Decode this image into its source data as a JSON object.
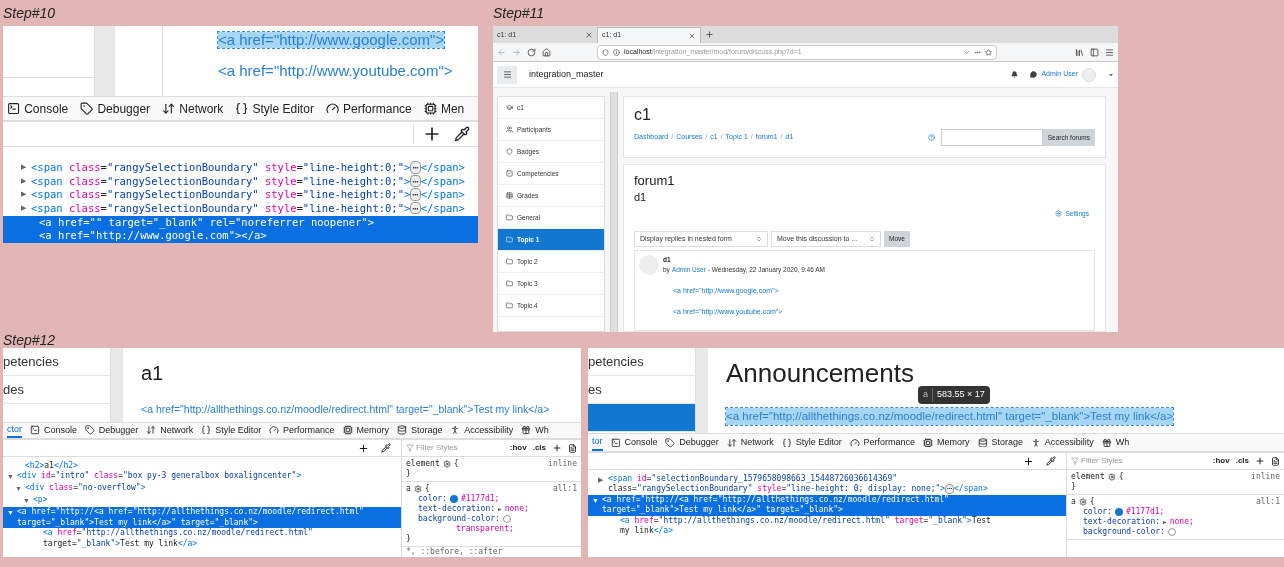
{
  "step10": {
    "label": "Step#10",
    "page_links": [
      {
        "text": "<a href=\"http://www.google.com\">",
        "selected": true
      },
      {
        "text": "<a href=\"http://www.youtube.com\">",
        "selected": false
      }
    ],
    "devtools_tabs": [
      {
        "label": "Console",
        "kind": "console",
        "selected": false
      },
      {
        "label": "Debugger",
        "kind": "debugger",
        "selected": false
      },
      {
        "label": "Network",
        "kind": "network",
        "selected": false
      },
      {
        "label": "Style Editor",
        "kind": "style",
        "selected": false
      },
      {
        "label": "Performance",
        "kind": "performance",
        "selected": false
      },
      {
        "label": "Men",
        "kind": "memory",
        "selected": false
      }
    ],
    "markup": [
      {
        "lines": [
          "<span class=\"rangySelectionBoundary\" style=\"line-height:0;\">⋯</span>"
        ],
        "arrow": "▶",
        "selected": false
      },
      {
        "lines": [
          "<span class=\"rangySelectionBoundary\" style=\"line-height:0;\">⋯</span>"
        ],
        "arrow": "▶",
        "selected": false
      },
      {
        "lines": [
          "<span class=\"rangySelectionBoundary\" style=\"line-height:0;\">⋯</span>"
        ],
        "arrow": "▶",
        "selected": false
      },
      {
        "lines": [
          "<span class=\"rangySelectionBoundary\" style=\"line-height:0;\">⋯</span>"
        ],
        "arrow": "▶",
        "selected": false
      },
      {
        "lines": [
          "<a href=\"\" target=\"_blank\" rel=\"noreferrer noopener\">",
          "<a href=\"http://www.google.com\"></a>"
        ],
        "selected": true
      }
    ]
  },
  "step11": {
    "label": "Step#11",
    "tabs": [
      {
        "label": "c1: d1",
        "selected": false
      },
      {
        "label": "c1: d1",
        "selected": true
      }
    ],
    "url_host": "localhost",
    "url_path": "/integration_master/mod/forum/discuss.php?d=1",
    "site_name": "integration_master",
    "user": "Admin User",
    "nav": [
      {
        "label": "c1",
        "kind": "course",
        "selected": false
      },
      {
        "label": "Participants",
        "kind": "participants",
        "selected": false
      },
      {
        "label": "Badges",
        "kind": "badges",
        "selected": false
      },
      {
        "label": "Competencies",
        "kind": "competencies",
        "selected": false
      },
      {
        "label": "Grades",
        "kind": "grades",
        "selected": false
      },
      {
        "label": "General",
        "kind": "section",
        "selected": false
      },
      {
        "label": "Topic 1",
        "kind": "section",
        "selected": true
      },
      {
        "label": "Topic 2",
        "kind": "section",
        "selected": false
      },
      {
        "label": "Topic 3",
        "kind": "section",
        "selected": false
      },
      {
        "label": "Topic 4",
        "kind": "section",
        "selected": false
      }
    ],
    "heading": "c1",
    "breadcrumb": [
      "Dashboard",
      "Courses",
      "c1",
      "Topic 1",
      "forum1",
      "d1"
    ],
    "breadcrumb_separator": "/",
    "search_button": "Search forums",
    "forum": "forum1",
    "discussion": "d1",
    "settings": "Settings",
    "display_select": "Display replies in nested form",
    "move_select": "Move this discussion to ...",
    "move_button": "Move",
    "post": {
      "title": "d1",
      "by": "by",
      "author": "Admin User",
      "date": "- Wednesday, 22 January 2020, 9:46 AM",
      "body": [
        "<a href=\"http://www.google.com\">",
        "<a href=\"http://www.youtube.com\">"
      ]
    }
  },
  "step12": {
    "label": "Step#12",
    "left": {
      "nav": [
        {
          "label": "petencies",
          "selected": false
        },
        {
          "label": "des",
          "selected": false
        }
      ],
      "heading": "a1",
      "link": "<a href=\"http://allthethings.co.nz/moodle/redirect.html\" target=\"_blank\">Test my link</a>",
      "link_selected": false,
      "devtools_tabs": [
        {
          "label": "ctor",
          "kind": "inspector",
          "selected": true
        },
        {
          "label": "Console",
          "kind": "console",
          "selected": false
        },
        {
          "label": "Debugger",
          "kind": "debugger",
          "selected": false
        },
        {
          "label": "Network",
          "kind": "network",
          "selected": false
        },
        {
          "label": "Style Editor",
          "kind": "style",
          "selected": false
        },
        {
          "label": "Performance",
          "kind": "performance",
          "selected": false
        },
        {
          "label": "Memory",
          "kind": "memory",
          "selected": false
        },
        {
          "label": "Storage",
          "kind": "storage",
          "selected": false
        },
        {
          "label": "Accessibility",
          "kind": "accessibility",
          "selected": false
        },
        {
          "label": "Wh",
          "kind": "whatsnew",
          "selected": false
        }
      ],
      "markup": [
        {
          "lines": [
            "<h2>a1</h2>"
          ],
          "selected": false
        },
        {
          "lines": [
            "<div id=\"intro\" class=\"box py-3 generalbox boxaligncenter\">"
          ],
          "arrow": "▼",
          "selected": false
        },
        {
          "lines": [
            "<div class=\"no-overflow\">"
          ],
          "arrow": "▼",
          "selected": false
        },
        {
          "lines": [
            "<p>"
          ],
          "arrow": "▼",
          "selected": false
        },
        {
          "lines": [
            "<a href=\"http://<a href=\"http://allthethings.co.nz/moodle/redirect.html\"",
            "target=\"_blank\">Test my link</a>\" target=\"_blank\">"
          ],
          "arrow": "▼",
          "selected": true
        },
        {
          "lines": [
            "<a href=\"http://allthethings.co.nz/moodle/redirect.html\"",
            "target=\"_blank\">Test my link</a>"
          ],
          "selected": false
        }
      ],
      "filter_placeholder": "Filter Styles",
      "hov": ":hov",
      "cls": ".cls",
      "rules": [
        {
          "selector": "element",
          "open": "{",
          "close": "}",
          "source": "inline"
        },
        {
          "selector": "a",
          "open": "{",
          "close": "}",
          "source": "all:1",
          "props": [
            {
              "name": "color:",
              "kind": "color",
              "value": "#1177d1;",
              "color": "#1177d1"
            },
            {
              "name": "text-decoration:",
              "kind": "plain",
              "arrow": "▶",
              "value": "none;"
            },
            {
              "name": "background-color:",
              "kind": "color",
              "value_below": "transparent;"
            }
          ]
        }
      ],
      "rules_more": "*, ::before, ::after"
    },
    "right": {
      "nav": [
        {
          "label": "petencies",
          "selected": false
        },
        {
          "label": "es",
          "selected": false
        },
        {
          "selected": true
        }
      ],
      "heading": "Announcements",
      "tooltip_tag": "a",
      "tooltip_size": "583.55 × 17",
      "link": "<a href=\"http://allthethings.co.nz/moodle/redirect.html\" target=\"_blank\">Test my link</a>",
      "link_selected": true,
      "devtools_tabs": [
        {
          "label": "tor",
          "kind": "inspector",
          "selected": true
        },
        {
          "label": "Console",
          "kind": "console",
          "selected": false
        },
        {
          "label": "Debugger",
          "kind": "debugger",
          "selected": false
        },
        {
          "label": "Network",
          "kind": "network",
          "selected": false
        },
        {
          "label": "Style Editor",
          "kind": "style",
          "selected": false
        },
        {
          "label": "Performance",
          "kind": "performance",
          "selected": false
        },
        {
          "label": "Memory",
          "kind": "memory",
          "selected": false
        },
        {
          "label": "Storage",
          "kind": "storage",
          "selected": false
        },
        {
          "label": "Accessibility",
          "kind": "accessibility",
          "selected": false
        },
        {
          "label": "Wh",
          "kind": "whatsnew",
          "selected": false
        }
      ],
      "markup": [
        {
          "lines": [
            "<span id=\"selectionBoundary_1579658098663_15448726036614369\"",
            "class=\"rangySelectionBoundary\" style=\"line-height: 0; display: none;\">⋯</span>"
          ],
          "arrow": "▶",
          "selected": false
        },
        {
          "lines": [
            "<a href=\"http://<a href=\"http://allthethings.co.nz/moodle/redirect.html\"",
            "target=\"_blank\">Test my link</a>\" target=\"_blank\">"
          ],
          "arrow": "▼",
          "selected": true
        },
        {
          "lines": [
            "<a href=\"http://allthethings.co.nz/moodle/redirect.html\" target=\"_blank\">Test",
            "my link</a>"
          ],
          "selected": false
        }
      ],
      "filter_placeholder": "Filter Styles",
      "hov": ":hov",
      "cls": ".cls",
      "rules": [
        {
          "selector": "element",
          "open": "{",
          "close": "}",
          "source": "inline"
        },
        {
          "selector": "a",
          "open": "{",
          "source": "all:1",
          "props": [
            {
              "name": "color:",
              "kind": "color",
              "value": "#1177d1;",
              "color": "#1177d1"
            },
            {
              "name": "text-decoration:",
              "kind": "plain",
              "arrow": "▶",
              "value": "none;"
            },
            {
              "name": "background-color:",
              "kind": "color"
            }
          ]
        }
      ]
    }
  }
}
